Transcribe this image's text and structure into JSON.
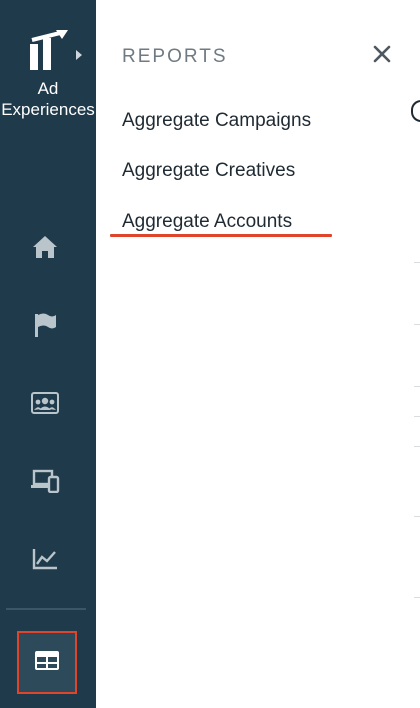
{
  "sidebar": {
    "brand_name": "Ad Experiences",
    "brand_icon": "ad-experiences-logo",
    "brand_expand_icon": "caret-right-icon",
    "nav": [
      {
        "icon": "home-icon"
      },
      {
        "icon": "flag-icon"
      },
      {
        "icon": "audience-icon"
      },
      {
        "icon": "devices-icon"
      },
      {
        "icon": "chart-icon"
      },
      {
        "icon": "reports-table-icon",
        "active": true
      }
    ]
  },
  "panel": {
    "title": "REPORTS",
    "close_icon": "close-icon",
    "items": [
      {
        "label": "Aggregate Campaigns"
      },
      {
        "label": "Aggregate Creatives"
      },
      {
        "label": "Aggregate Accounts",
        "highlighted": true
      }
    ]
  },
  "colors": {
    "sidebar_bg": "#1f3a4a",
    "highlight": "#e0452c",
    "icon": "#b9c4cb",
    "text": "#1f2a33",
    "title": "#6f7a83"
  }
}
